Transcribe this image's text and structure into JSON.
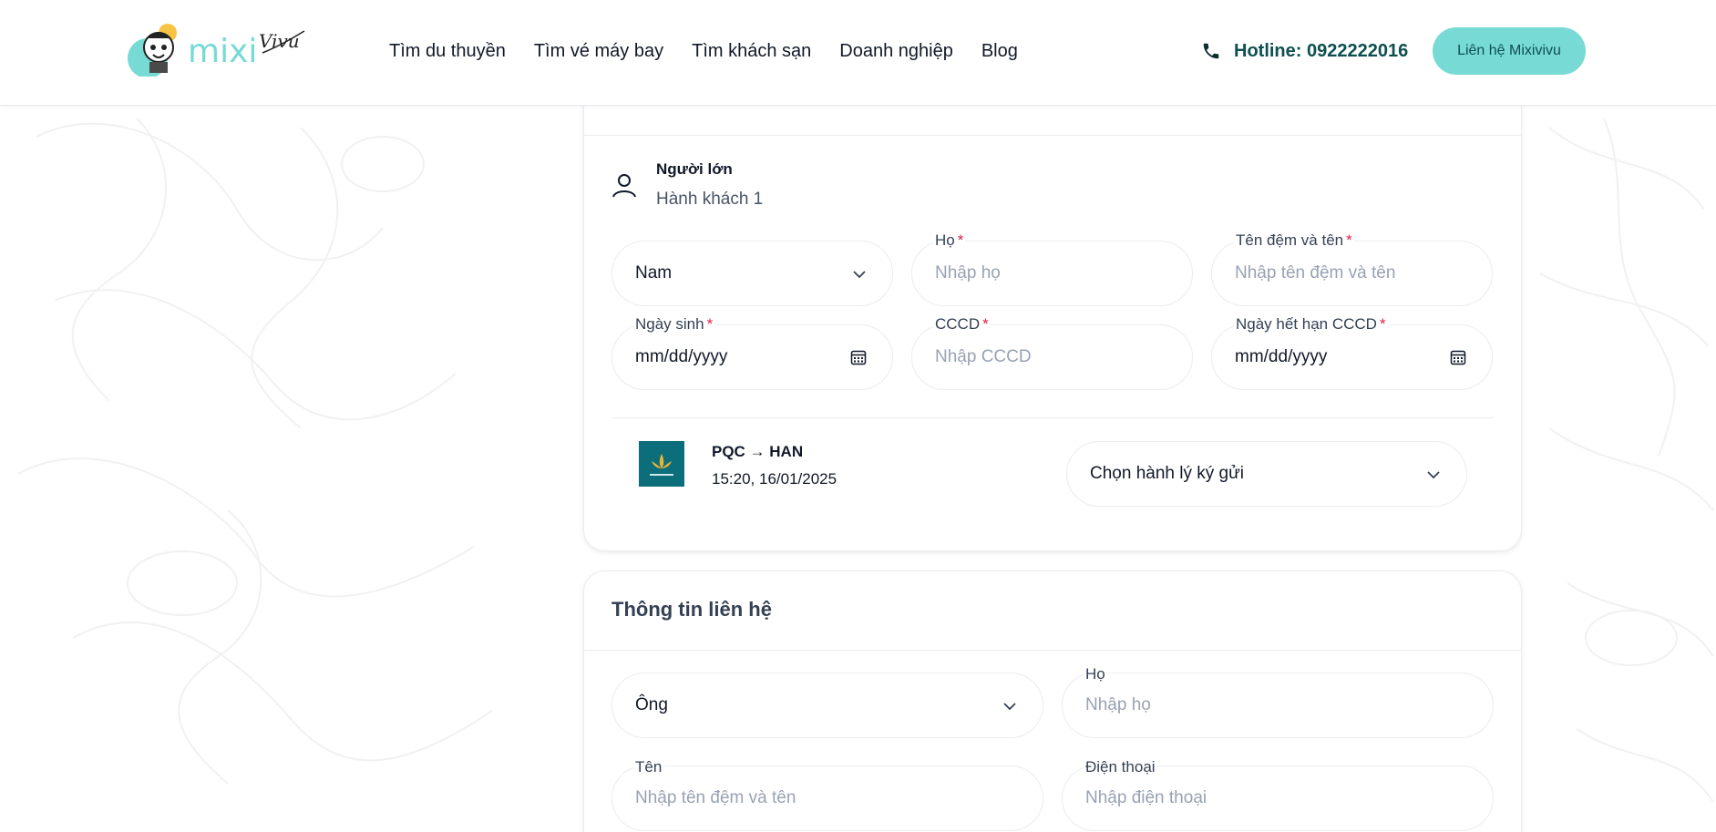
{
  "header": {
    "logo_alt": "mixi Vivu",
    "nav": [
      "Tìm du thuyền",
      "Tìm vé máy bay",
      "Tìm khách sạn",
      "Doanh nghiệp",
      "Blog"
    ],
    "hotline": "Hotline: 0922222016",
    "contact_button": "Liên hệ Mixivivu"
  },
  "passenger": {
    "type": "Người lớn",
    "name": "Hành khách 1",
    "gender": {
      "value": "Nam"
    },
    "last_name": {
      "label": "Họ",
      "placeholder": "Nhập họ"
    },
    "first_name": {
      "label": "Tên đệm và tên",
      "placeholder": "Nhập tên đệm và tên"
    },
    "dob": {
      "label": "Ngày sinh",
      "value": "mm/dd/yyyy"
    },
    "id_card": {
      "label": "CCCD",
      "placeholder": "Nhập CCCD"
    },
    "id_expiry": {
      "label": "Ngày hết hạn CCCD",
      "value": "mm/dd/yyyy"
    },
    "required_mark": "*"
  },
  "flight": {
    "route": "PQC → HAN",
    "datetime": "15:20, 16/01/2025",
    "baggage_select": "Chọn hành lý ký gửi"
  },
  "contact": {
    "title": "Thông tin liên hệ",
    "salutation": {
      "value": "Ông"
    },
    "last_name": {
      "label": "Họ",
      "placeholder": "Nhập họ"
    },
    "first_name": {
      "label": "Tên",
      "placeholder": "Nhập tên đệm và tên"
    },
    "phone": {
      "label": "Điện thoại",
      "placeholder": "Nhập điện thoại"
    }
  },
  "colors": {
    "accent": "#77dad5",
    "hotline": "#0e4f4f",
    "required": "#e11d48",
    "placeholder": "#98a2b3"
  }
}
